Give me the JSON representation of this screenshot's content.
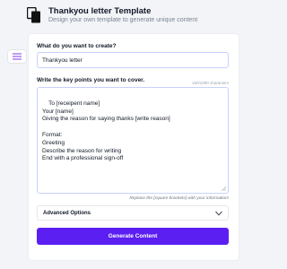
{
  "header": {
    "title": "Thankyou letter Template",
    "subtitle": "Design your own template to generate unique content"
  },
  "icons": {
    "doc": "copy-document-icon",
    "side": "list-lines-icon",
    "options": "chevron-down-icon"
  },
  "form": {
    "create_label": "What do you want to create?",
    "create_value": "Thankyou letter",
    "points_label": "Write the key points you want to cover.",
    "char_count": "150/1000 characters",
    "points_value": "To [receipent name]\nYour [name]\nGiving the reason for saying thanks [write reason]\n\nFormat:\nGreeting\nDescribe the reason for writing\nEnd with a professional sign-off",
    "hint": "Replace the [square brackets] with your information!",
    "advanced_label": "Advanced Options",
    "generate_label": "Generate Content"
  },
  "colors": {
    "accent": "#5b1ff2",
    "input_border": "#c7d2fe",
    "side_icon": "#7c3aed"
  }
}
